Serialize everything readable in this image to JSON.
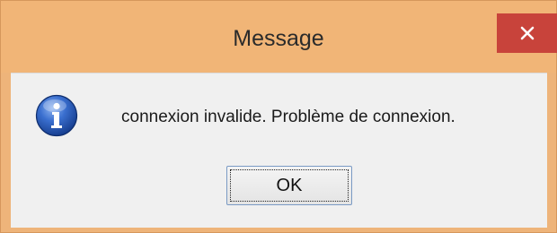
{
  "window": {
    "title": "Message",
    "close_icon": "close-icon",
    "close_color": "#c8433b",
    "titlebar_color": "#f1b577"
  },
  "dialog": {
    "icon": "info-icon",
    "message": "connexion invalide. Problème de connexion.",
    "ok_label": "OK"
  }
}
